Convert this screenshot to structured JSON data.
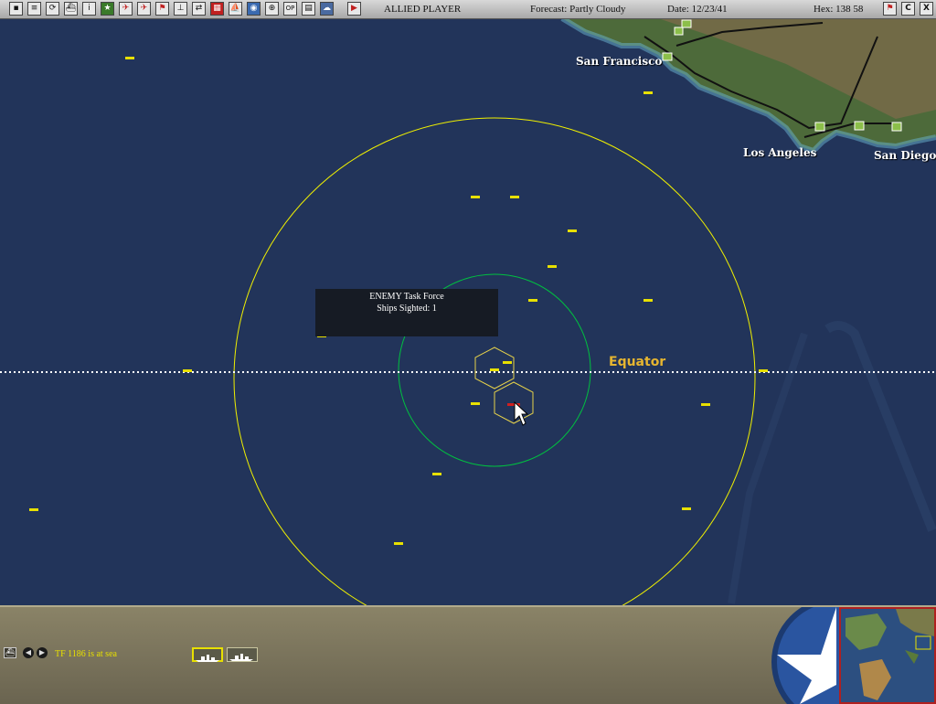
{
  "topbar": {
    "icons": [
      "save-icon",
      "report-icon",
      "refresh-icon",
      "ships-icon",
      "info-icon",
      "star-icon",
      "aircraft-icon",
      "bomber-icon",
      "flag-icon",
      "carrier-icon",
      "transfer-icon",
      "chart-icon",
      "taskforce-icon",
      "globe-icon",
      "target-icon",
      "op-icon",
      "grid-icon",
      "weather-icon",
      "play-icon"
    ],
    "player": "ALLIED PLAYER",
    "forecast": "Forecast: Partly Cloudy",
    "date": "Date: 12/23/41",
    "hex": "Hex: 138  58",
    "right_icons": [
      "flag-icon",
      "c-icon",
      "close-icon"
    ],
    "c_label": "C",
    "close_label": "X"
  },
  "map": {
    "cities": [
      "San Francisco",
      "Los Angeles",
      "San Diego"
    ],
    "equator_label": "Equator",
    "tooltip": {
      "line1": "ENEMY Task Force",
      "line2": "Ships Sighted: 1"
    }
  },
  "bottom": {
    "status": "TF 1186 is at sea"
  },
  "colors": {
    "ocean": "#22345a",
    "range_outer": "#f0f000",
    "range_inner": "#00c040",
    "hex_outline": "#e6d24a",
    "status_text": "#e8e000"
  }
}
